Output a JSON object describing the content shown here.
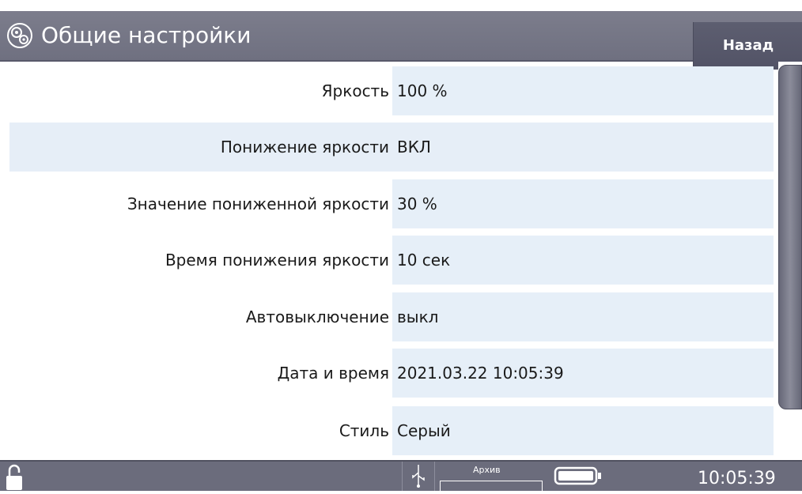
{
  "header": {
    "title": "Общие настройки",
    "back_label": "Назад",
    "icon": "gear-icon"
  },
  "settings": [
    {
      "label": "Яркость",
      "value": "100 %"
    },
    {
      "label": "Понижение яркости",
      "value": "ВКЛ",
      "selected": true
    },
    {
      "label": "Значение пониженной яркости",
      "value": "30 %"
    },
    {
      "label": "Время понижения яркости",
      "value": "10 сек"
    },
    {
      "label": "Автовыключение",
      "value": "выкл"
    },
    {
      "label": "Дата и время",
      "value": "2021.03.22 10:05:39"
    },
    {
      "label": "Стиль",
      "value": "Серый"
    }
  ],
  "status_bar": {
    "archive_label": "Архив",
    "time": "10:05:39",
    "icons": [
      "lock-icon",
      "usb-icon",
      "battery-icon"
    ]
  },
  "colors": {
    "header_bg": "#74758a",
    "back_button_bg": "#57586b",
    "value_bg": "#e6eff8",
    "status_bg": "#6b6c7c"
  }
}
